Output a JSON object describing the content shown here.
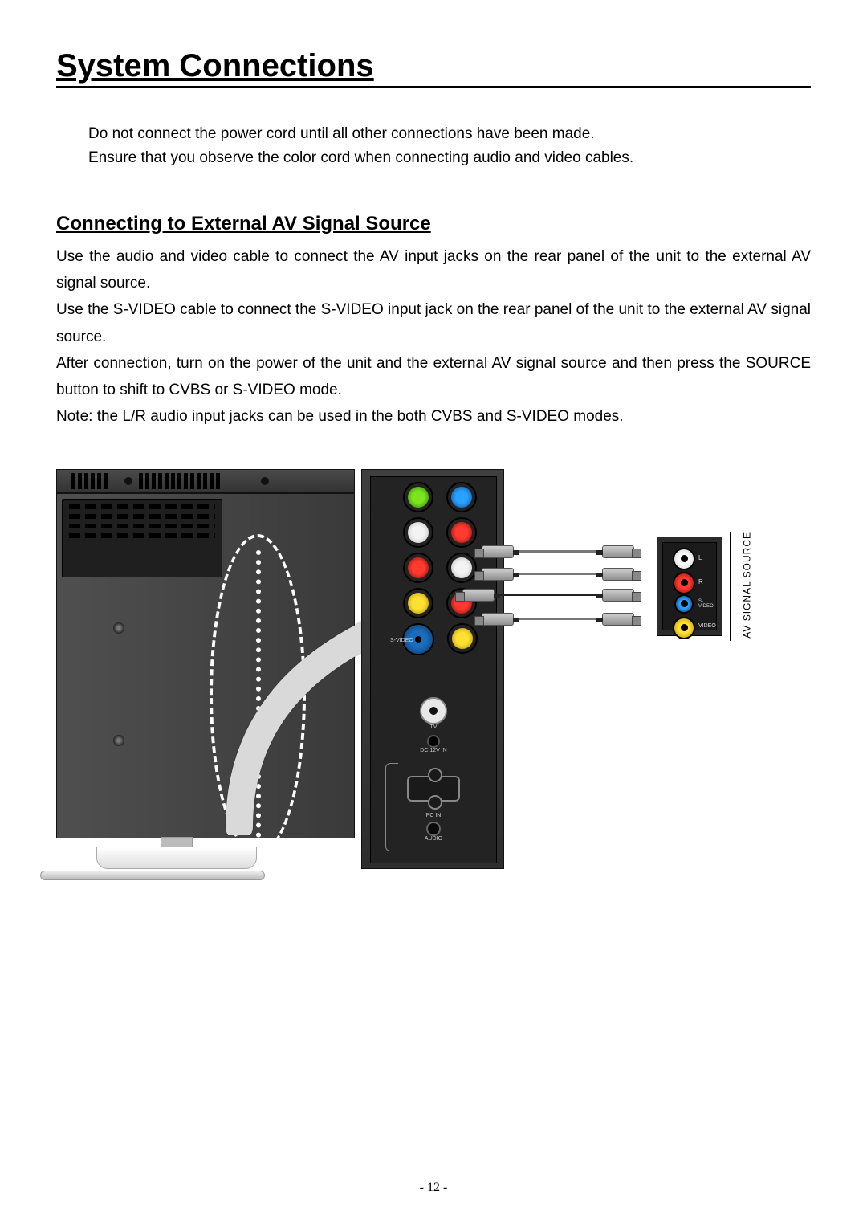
{
  "page": {
    "title": "System Connections",
    "intro_lines": [
      "Do not connect the power cord until all other connections have been made.",
      "Ensure that you observe the color cord when connecting audio and video cables."
    ],
    "subtitle": "Connecting to External AV Signal Source",
    "paragraphs": [
      "Use the audio and video cable to connect the AV input jacks on the rear panel of the unit to the external AV signal source.",
      "Use the S-VIDEO cable to connect the S-VIDEO input jack on the rear panel of the unit to the external AV signal source.",
      "After connection, turn on the power of the unit and the external AV signal source and then press the SOURCE button to shift to CVBS or S-VIDEO mode.",
      "Note: the L/R audio input jacks can be used in the both CVBS and S-VIDEO modes."
    ],
    "page_number": "- 12 -"
  },
  "diagram": {
    "rear_panel": {
      "svideo_label": "S-VIDEO",
      "tv_label": "TV",
      "dc_label": "DC 12V IN",
      "pc_label": "PC IN",
      "audio_label": "AUDIO"
    },
    "source_box": {
      "title": "AV SIGNAL SOURCE",
      "jacks": {
        "l": "L",
        "r": "R",
        "svideo": "S-VIDEO",
        "video": "VIDEO"
      }
    }
  }
}
